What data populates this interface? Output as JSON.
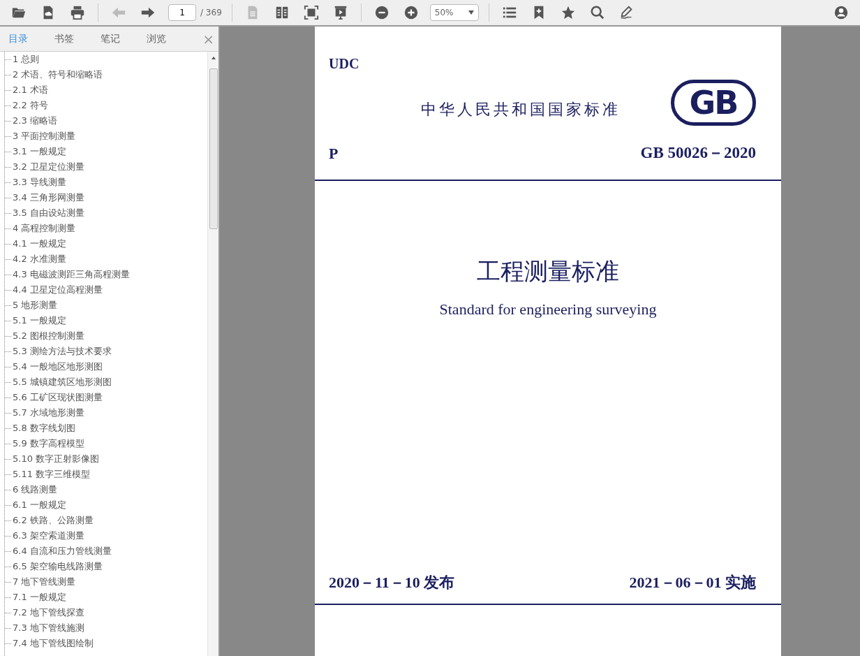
{
  "toolbar": [
    {
      "kind": "button",
      "disabled": false
    },
    {
      "kind": "button",
      "disabled": false
    },
    {
      "kind": "button",
      "disabled": false
    },
    {
      "kind": "separator"
    },
    {
      "kind": "button",
      "disabled": true
    },
    {
      "kind": "button",
      "disabled": false
    },
    {
      "kind": "page-field",
      "value": "1",
      "total": "/ 369"
    },
    {
      "kind": "separator"
    },
    {
      "kind": "button",
      "disabled": true
    },
    {
      "kind": "button",
      "disabled": false
    },
    {
      "kind": "button",
      "disabled": false
    },
    {
      "kind": "button",
      "disabled": false
    },
    {
      "kind": "separator"
    },
    {
      "kind": "button",
      "disabled": false
    },
    {
      "kind": "button",
      "disabled": false
    },
    {
      "kind": "select",
      "value": "50%"
    },
    {
      "kind": "separator"
    },
    {
      "kind": "button",
      "disabled": false
    },
    {
      "kind": "button",
      "disabled": false
    },
    {
      "kind": "button",
      "disabled": false
    },
    {
      "kind": "button",
      "disabled": false
    },
    {
      "kind": "button",
      "disabled": false
    },
    {
      "kind": "spacer"
    },
    {
      "kind": "button",
      "disabled": false
    }
  ],
  "sidebar": {
    "tabs": [
      {
        "label": "目录",
        "selected": true
      },
      {
        "label": "书签",
        "selected": false
      },
      {
        "label": "笔记",
        "selected": false
      },
      {
        "label": "浏览",
        "selected": false
      }
    ],
    "close": "×",
    "toc": [
      {
        "label": "1 总则"
      },
      {
        "label": "2 术语、符号和缩略语"
      },
      {
        "label": "2.1 术语"
      },
      {
        "label": "2.2 符号"
      },
      {
        "label": "2.3 缩略语"
      },
      {
        "label": "3 平面控制测量"
      },
      {
        "label": "3.1 一般规定"
      },
      {
        "label": "3.2 卫星定位测量"
      },
      {
        "label": "3.3 导线测量"
      },
      {
        "label": "3.4 三角形网测量"
      },
      {
        "label": "3.5 自由设站测量"
      },
      {
        "label": "4 高程控制测量"
      },
      {
        "label": "4.1 一般规定"
      },
      {
        "label": "4.2 水准测量"
      },
      {
        "label": "4.3 电磁波测距三角高程测量"
      },
      {
        "label": "4.4 卫星定位高程测量"
      },
      {
        "label": "5 地形测量"
      },
      {
        "label": "5.1 一般规定"
      },
      {
        "label": "5.2 图根控制测量"
      },
      {
        "label": "5.3 测绘方法与技术要求"
      },
      {
        "label": "5.4 一般地区地形测图"
      },
      {
        "label": "5.5 城镇建筑区地形测图"
      },
      {
        "label": "5.6 工矿区现状图测量"
      },
      {
        "label": "5.7 水域地形测量"
      },
      {
        "label": "5.8 数字线划图"
      },
      {
        "label": "5.9 数字高程模型"
      },
      {
        "label": "5.10 数字正射影像图"
      },
      {
        "label": "5.11 数字三维模型"
      },
      {
        "label": "6 线路测量"
      },
      {
        "label": "6.1 一般规定"
      },
      {
        "label": "6.2 铁路、公路测量"
      },
      {
        "label": "6.3 架空索道测量"
      },
      {
        "label": "6.4 自流和压力管线测量"
      },
      {
        "label": "6.5 架空输电线路测量"
      },
      {
        "label": "7 地下管线测量"
      },
      {
        "label": "7.1 一般规定"
      },
      {
        "label": "7.2 地下管线探查"
      },
      {
        "label": "7.3 地下管线施测"
      },
      {
        "label": "7.4 地下管线图绘制"
      }
    ]
  },
  "document_page": {
    "udc": "UDC",
    "issuer": "中华人民共和国国家标准",
    "logo": "GB",
    "category": "P",
    "code": "GB 50026－2020",
    "title": "工程测量标准",
    "title_en": "Standard for engineering surveying",
    "issued": "2020－11－10 发布",
    "effective": "2021－06－01 实施"
  }
}
